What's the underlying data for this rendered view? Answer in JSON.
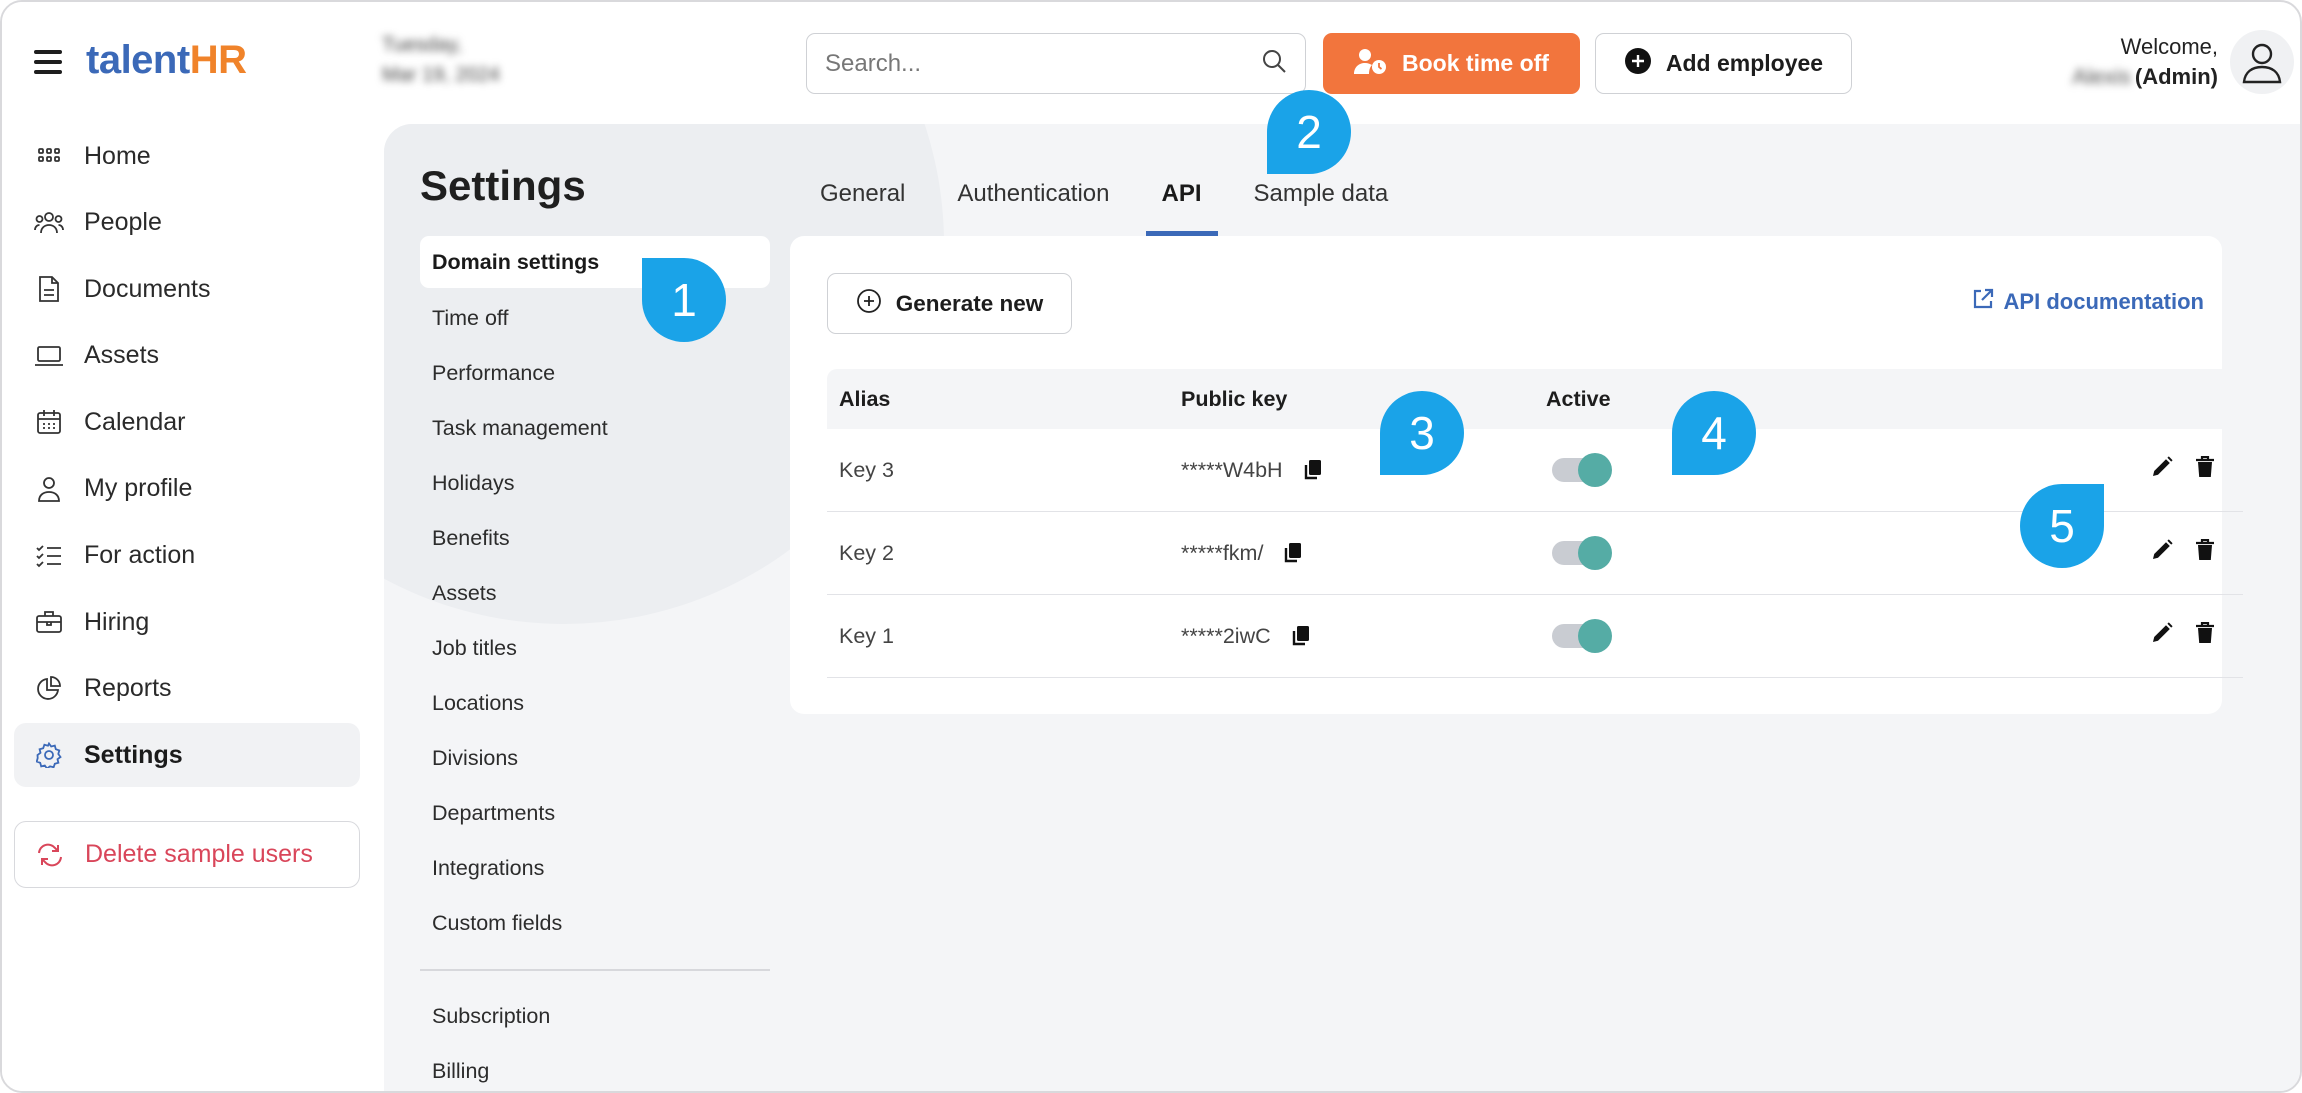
{
  "app": {
    "logo_part1": "talent",
    "logo_part2": "HR"
  },
  "sidebar": {
    "items": [
      {
        "label": "Home",
        "icon": "grid-icon"
      },
      {
        "label": "People",
        "icon": "people-icon"
      },
      {
        "label": "Documents",
        "icon": "document-icon"
      },
      {
        "label": "Assets",
        "icon": "laptop-icon"
      },
      {
        "label": "Calendar",
        "icon": "calendar-icon"
      },
      {
        "label": "My profile",
        "icon": "user-icon"
      },
      {
        "label": "For action",
        "icon": "checklist-icon"
      },
      {
        "label": "Hiring",
        "icon": "briefcase-icon"
      },
      {
        "label": "Reports",
        "icon": "pie-chart-icon"
      },
      {
        "label": "Settings",
        "icon": "gear-icon"
      }
    ],
    "active": "Settings",
    "delete_sample_label": "Delete sample users"
  },
  "header": {
    "date_day": "Tuesday,",
    "date_full": "Mar 19, 2024",
    "search_placeholder": "Search...",
    "book_time_off_label": "Book time off",
    "add_employee_label": "Add employee",
    "welcome_label": "Welcome,",
    "user_name": "Alexis",
    "user_role": "(Admin)"
  },
  "settings": {
    "title": "Settings",
    "subnav": [
      "Domain settings",
      "Time off",
      "Performance",
      "Task management",
      "Holidays",
      "Benefits",
      "Assets",
      "Job titles",
      "Locations",
      "Divisions",
      "Departments",
      "Integrations",
      "Custom fields"
    ],
    "subnav_bottom": [
      "Subscription",
      "Billing"
    ],
    "active_subnav": "Domain settings",
    "tabs": [
      "General",
      "Authentication",
      "API",
      "Sample data"
    ],
    "active_tab": "API"
  },
  "api": {
    "generate_label": "Generate new",
    "docs_label": "API documentation",
    "columns": [
      "Alias",
      "Public key",
      "Active"
    ],
    "rows": [
      {
        "alias": "Key 3",
        "public_key": "*****W4bH",
        "active": true
      },
      {
        "alias": "Key 2",
        "public_key": "*****fkm/",
        "active": true
      },
      {
        "alias": "Key 1",
        "public_key": "*****2iwC",
        "active": true
      }
    ]
  },
  "callouts": [
    "1",
    "2",
    "3",
    "4",
    "5"
  ],
  "colors": {
    "accent": "#3b69b8",
    "orange": "#f2753d",
    "callout": "#1aa3e8",
    "toggle_on": "#55aca5",
    "danger": "#d9465a"
  }
}
